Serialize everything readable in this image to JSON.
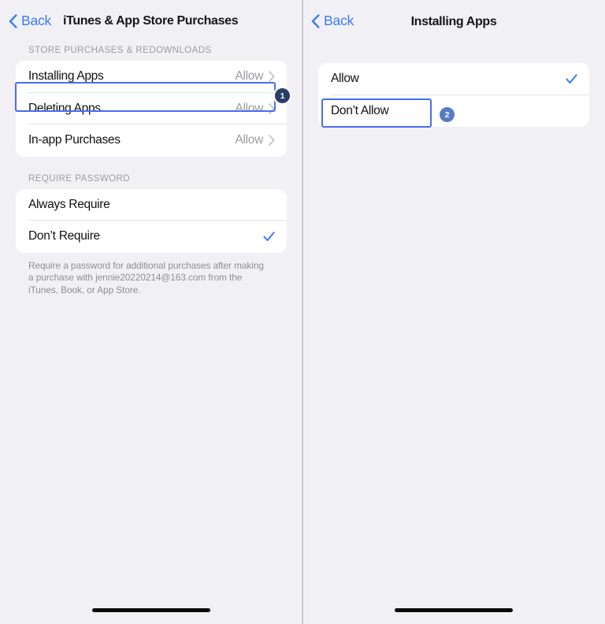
{
  "left_screen": {
    "nav": {
      "back_label": "Back",
      "back_icon": "chevron-left-icon",
      "title": "iTunes & App Store Purchases"
    },
    "sections": [
      {
        "header": "STORE PURCHASES & REDOWNLOADS",
        "rows": [
          {
            "label": "Installing Apps",
            "value": "Allow",
            "accessory": "chevron-right-icon",
            "highlighted": true
          },
          {
            "label": "Deleting Apps",
            "value": "Allow",
            "accessory": "chevron-right-icon",
            "highlighted": false
          },
          {
            "label": "In-app Purchases",
            "value": "Allow",
            "accessory": "chevron-right-icon",
            "highlighted": false
          }
        ]
      },
      {
        "header": "REQUIRE PASSWORD",
        "rows": [
          {
            "label": "Always Require",
            "value": "",
            "accessory": "none",
            "selected": false
          },
          {
            "label": "Don’t Require",
            "value": "",
            "accessory": "checkmark-icon",
            "selected": true
          }
        ],
        "footer": "Require a password for additional purchases after making a purchase with jennie20220214@163.com from the iTunes, Book, or App Store."
      }
    ],
    "badge": {
      "number": "1",
      "color": "#2a3c68"
    }
  },
  "right_screen": {
    "nav": {
      "back_label": "Back",
      "back_icon": "chevron-left-icon",
      "title": "Installing Apps"
    },
    "options": [
      {
        "label": "Allow",
        "accessory": "checkmark-icon",
        "selected": true,
        "highlighted": false
      },
      {
        "label": "Don’t Allow",
        "accessory": "none",
        "selected": false,
        "highlighted": true
      }
    ],
    "badge": {
      "number": "2",
      "color": "#577cc0"
    }
  },
  "theme": {
    "accent_blue": "#3b7bf6",
    "highlight_border": "#4a6cf0",
    "background": "#f1f1f5",
    "card_background": "#ffffff",
    "secondary_text": "#9b9ba1"
  }
}
